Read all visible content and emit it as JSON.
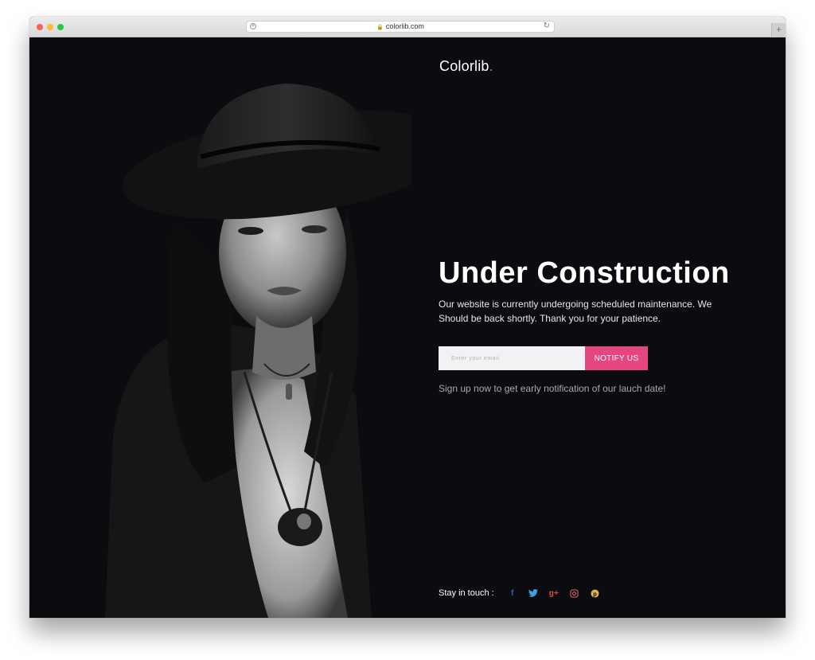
{
  "browser": {
    "url": "colorlib.com"
  },
  "page": {
    "brand": "Colorlib",
    "brand_dot": ".",
    "headline": "Under Construction",
    "description": "Our website is currently undergoing scheduled maintenance. We Should be back shortly. Thank you for your patience.",
    "email_placeholder": "Enter your email",
    "notify_label": "NOTIFY US",
    "signup_note": "Sign up now to get early notification of our lauch date!",
    "stay_in_touch": "Stay in touch :",
    "social": [
      {
        "icon": "facebook-icon",
        "glyph": "f",
        "color": "#3b5bbd"
      },
      {
        "icon": "twitter-icon",
        "glyph": "t",
        "color": "#3aa0e8"
      },
      {
        "icon": "google-plus-icon",
        "glyph": "g+",
        "color": "#dd4b39"
      },
      {
        "icon": "instagram-icon",
        "glyph": "◘",
        "color": "#c85c5c"
      },
      {
        "icon": "pinterest-icon",
        "glyph": "p",
        "color": "#e0b34a"
      }
    ],
    "accent_color": "#e6467f"
  }
}
